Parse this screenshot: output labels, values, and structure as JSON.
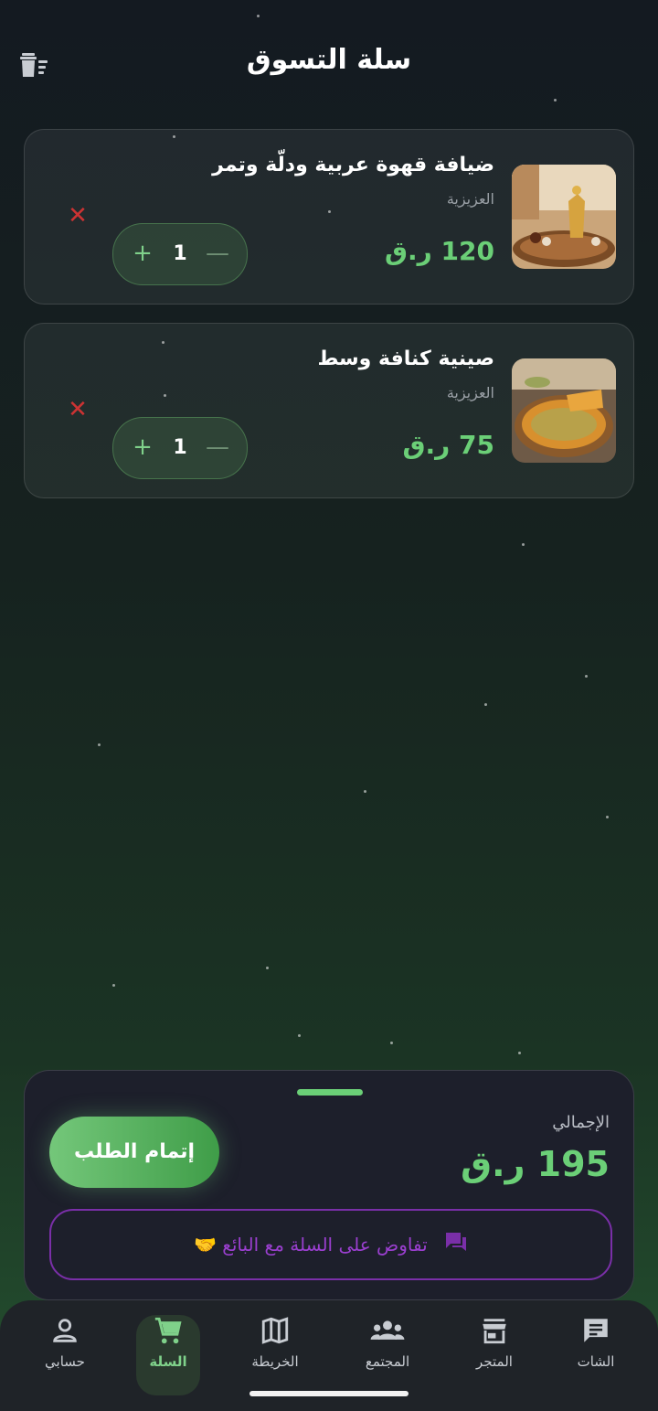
{
  "header": {
    "title": "سلة التسوق",
    "clear_icon": "clear-cart-icon"
  },
  "cart": {
    "items": [
      {
        "name": "ضيافة قهوة عربية ودلّة وتمر",
        "shop": "العزيزية",
        "price": "120 ر.ق",
        "quantity": "1"
      },
      {
        "name": "صينية كنافة وسط",
        "shop": "العزيزية",
        "price": "75 ر.ق",
        "quantity": "1"
      }
    ],
    "remove_symbol": "✕",
    "plus_symbol": "+",
    "minus_symbol": "—"
  },
  "summary": {
    "total_label": "الإجمالي",
    "total_value": "195 ر.ق",
    "checkout_label": "إتمام الطلب",
    "negotiate_label": "تفاوض على السلة مع البائع 🤝"
  },
  "nav": {
    "items": [
      {
        "label": "حسابي",
        "icon": "person-icon"
      },
      {
        "label": "السلة",
        "icon": "cart-icon"
      },
      {
        "label": "الخريطة",
        "icon": "map-icon"
      },
      {
        "label": "المجتمع",
        "icon": "community-icon"
      },
      {
        "label": "المتجر",
        "icon": "store-icon"
      },
      {
        "label": "الشات",
        "icon": "chat-icon"
      }
    ],
    "active": "السلة"
  },
  "colors": {
    "accent": "#6bcf77",
    "negotiate": "#9a3fcf",
    "remove": "#cc3333"
  }
}
